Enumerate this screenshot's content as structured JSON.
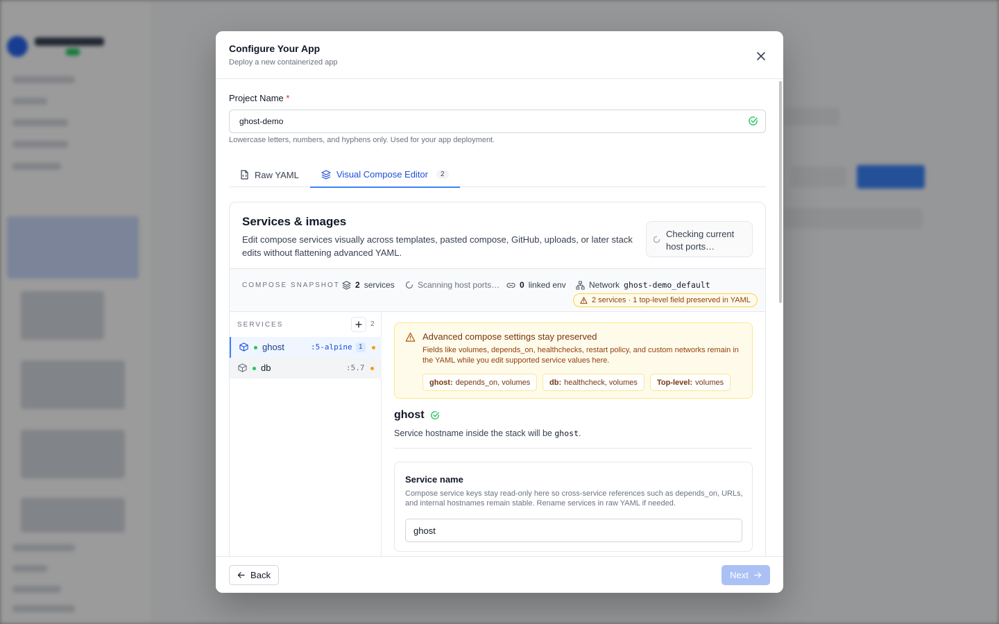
{
  "modal": {
    "title": "Configure Your App",
    "subtitle": "Deploy a new containerized app"
  },
  "project": {
    "label": "Project Name",
    "required_mark": "*",
    "value": "ghost-demo",
    "hint": "Lowercase letters, numbers, and hyphens only. Used for your app deployment."
  },
  "tabs": [
    {
      "label": "Raw YAML",
      "icon": "file-code-icon",
      "active": false
    },
    {
      "label": "Visual Compose Editor",
      "icon": "layers-icon",
      "badge": "2",
      "active": true
    }
  ],
  "services_card": {
    "title": "Services & images",
    "description": "Edit compose services visually across templates, pasted compose, GitHub, uploads, or later stack edits without flattening advanced YAML.",
    "checking_status": "Checking current host ports…"
  },
  "snapshot": {
    "label": "COMPOSE SNAPSHOT",
    "services_count": "2",
    "services_label": "services",
    "scanning": "Scanning host ports…",
    "linked_env_count": "0",
    "linked_env_label": "linked env",
    "network_label": "Network",
    "network_name": "ghost-demo_default",
    "warning": "2 services · 1 top-level field preserved in YAML"
  },
  "services_list": {
    "heading": "SERVICES",
    "count": "2",
    "items": [
      {
        "name": "ghost",
        "tag": ":5-alpine",
        "badge": "1",
        "active": true
      },
      {
        "name": "db",
        "tag": ":5.7",
        "active": false
      }
    ]
  },
  "advanced": {
    "title": "Advanced compose settings stay preserved",
    "body": "Fields like volumes, depends_on, healthchecks, restart policy, and custom networks remain in the YAML while you edit supported service values here.",
    "chips": [
      {
        "key": "ghost:",
        "value": "depends_on, volumes"
      },
      {
        "key": "db:",
        "value": "healthcheck, volumes"
      },
      {
        "key": "Top-level:",
        "value": "volumes"
      }
    ]
  },
  "service_detail": {
    "name": "ghost",
    "hostname_prefix": "Service hostname inside the stack will be",
    "hostname": "ghost",
    "hostname_suffix": ".",
    "name_card_title": "Service name",
    "name_card_desc": "Compose service keys stay read-only here so cross-service references such as depends_on, URLs, and internal hostnames remain stable. Rename services in raw YAML if needed.",
    "name_value": "ghost"
  },
  "footer": {
    "back": "Back",
    "next": "Next"
  },
  "colors": {
    "accent": "#3b82f6",
    "success": "#22c55e",
    "warning": "#f59e0b"
  }
}
